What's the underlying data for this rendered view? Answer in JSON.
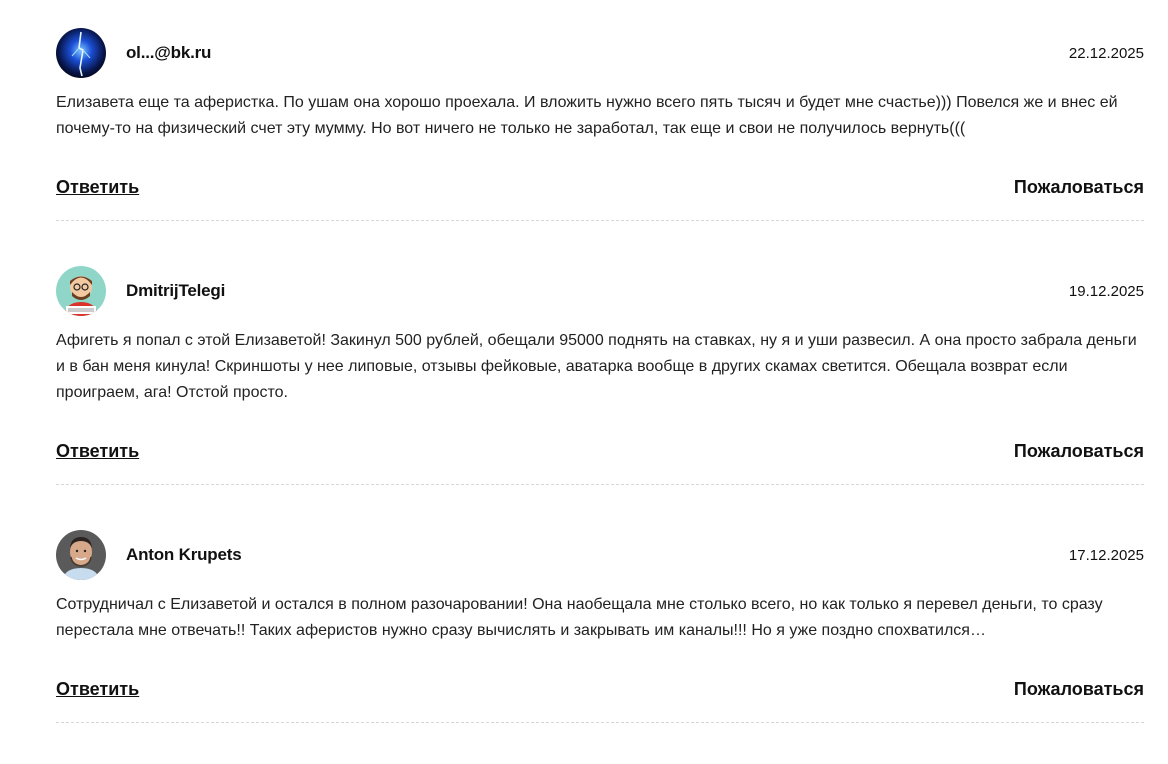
{
  "comments": [
    {
      "author": "ol...@bk.ru",
      "date": "22.12.2025",
      "avatar_icon": "blue-storm-avatar-icon",
      "text": "Елизавета еще та аферистка. По ушам она хорошо проехала. И вложить нужно всего пять тысяч и будет мне счастье))) Повелся же и внес ей почему-то на физический счет эту мумму. Но вот ничего не только не заработал, так еще и свои не получилось вернуть(((",
      "reply_label": "Ответить",
      "report_label": "Пожаловаться"
    },
    {
      "author": "DmitrijTelegi",
      "date": "19.12.2025",
      "avatar_icon": "cartoon-man-avatar-icon",
      "text": "Афигеть я попал с этой Елизаветой! Закинул 500 рублей, обещали 95000 поднять на ставках, ну я и уши развесил. А она просто забрала деньги и в бан меня кинула! Скриншоты у нее липовые, отзывы фейковые, аватарка вообще в других скамах светится. Обещала возврат если проиграем, ага! Отстой просто.",
      "reply_label": "Ответить",
      "report_label": "Пожаловаться"
    },
    {
      "author": "Anton Krupets",
      "date": "17.12.2025",
      "avatar_icon": "man-photo-avatar-icon",
      "text": "Сотрудничал с Елизаветой и остался в полном разочаровании! Она наобещала мне столько всего, но как только я перевел деньги, то сразу перестала мне отвечать!! Таких аферистов нужно сразу вычислять и закрывать им каналы!!! Но я уже поздно спохватился…",
      "reply_label": "Ответить",
      "report_label": "Пожаловаться"
    }
  ]
}
